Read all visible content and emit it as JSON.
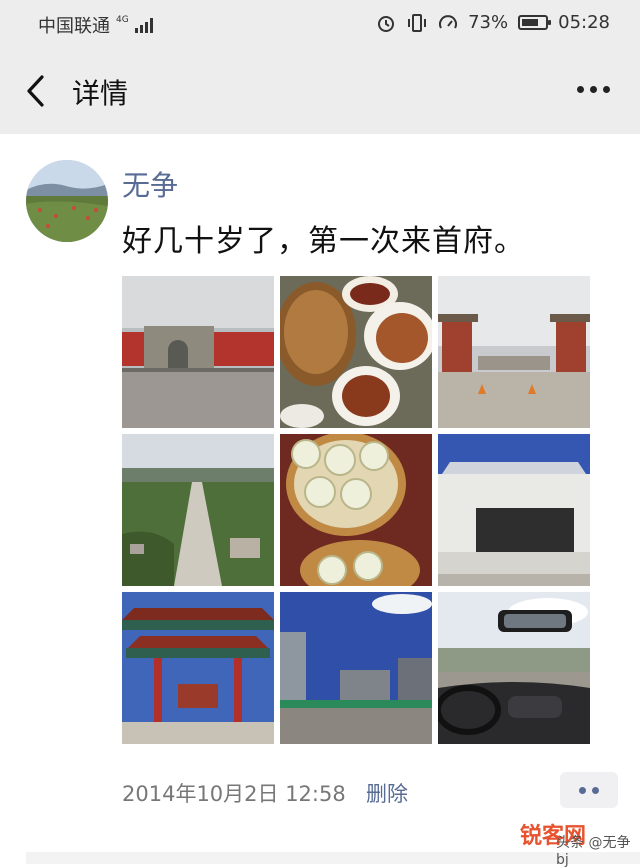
{
  "status": {
    "carrier": "中国联通",
    "network": "4G",
    "battery": "73%",
    "battery_level": 0.73,
    "time": "05:28"
  },
  "nav": {
    "title": "详情",
    "back_icon": "chevron-left-icon",
    "more_icon": "more-icon"
  },
  "post": {
    "author": "无争",
    "text": "好几十岁了，第一次来首府。",
    "timestamp": "2014年10月2日 12:58",
    "delete_label": "删除"
  },
  "photos": [
    {
      "name": "photo-city-wall"
    },
    {
      "name": "photo-noodles"
    },
    {
      "name": "photo-gate-square"
    },
    {
      "name": "photo-aerial-avenue"
    },
    {
      "name": "photo-shaomai"
    },
    {
      "name": "photo-stone-gate"
    },
    {
      "name": "photo-pailou-archway"
    },
    {
      "name": "photo-plaza"
    },
    {
      "name": "photo-car-interior"
    }
  ],
  "watermark": {
    "logo_text": "锐客网",
    "sub_text": "头条 @无争bj"
  }
}
